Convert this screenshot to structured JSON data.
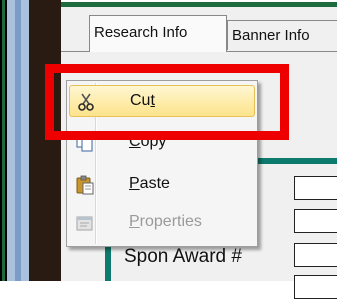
{
  "tabs": [
    {
      "label": "Research Info",
      "active": true
    },
    {
      "label": "Banner Info",
      "active": false
    }
  ],
  "context_menu": {
    "items": [
      {
        "label": "Cut",
        "accel_index": 2,
        "icon": "scissors-icon",
        "state": "hover"
      },
      {
        "label": "Copy",
        "accel_index": 0,
        "icon": "copy-icon",
        "state": "normal"
      },
      {
        "label": "Paste",
        "accel_index": 0,
        "icon": "paste-icon",
        "state": "normal"
      },
      {
        "label": "Properties",
        "accel_index": 0,
        "icon": "properties-icon",
        "state": "disabled"
      }
    ]
  },
  "form": {
    "spon_award_label": "Spon Award #"
  },
  "colors": {
    "highlight": "#ee0000",
    "teal": "#0c7a6c",
    "menu_hover": "#fde38a"
  }
}
